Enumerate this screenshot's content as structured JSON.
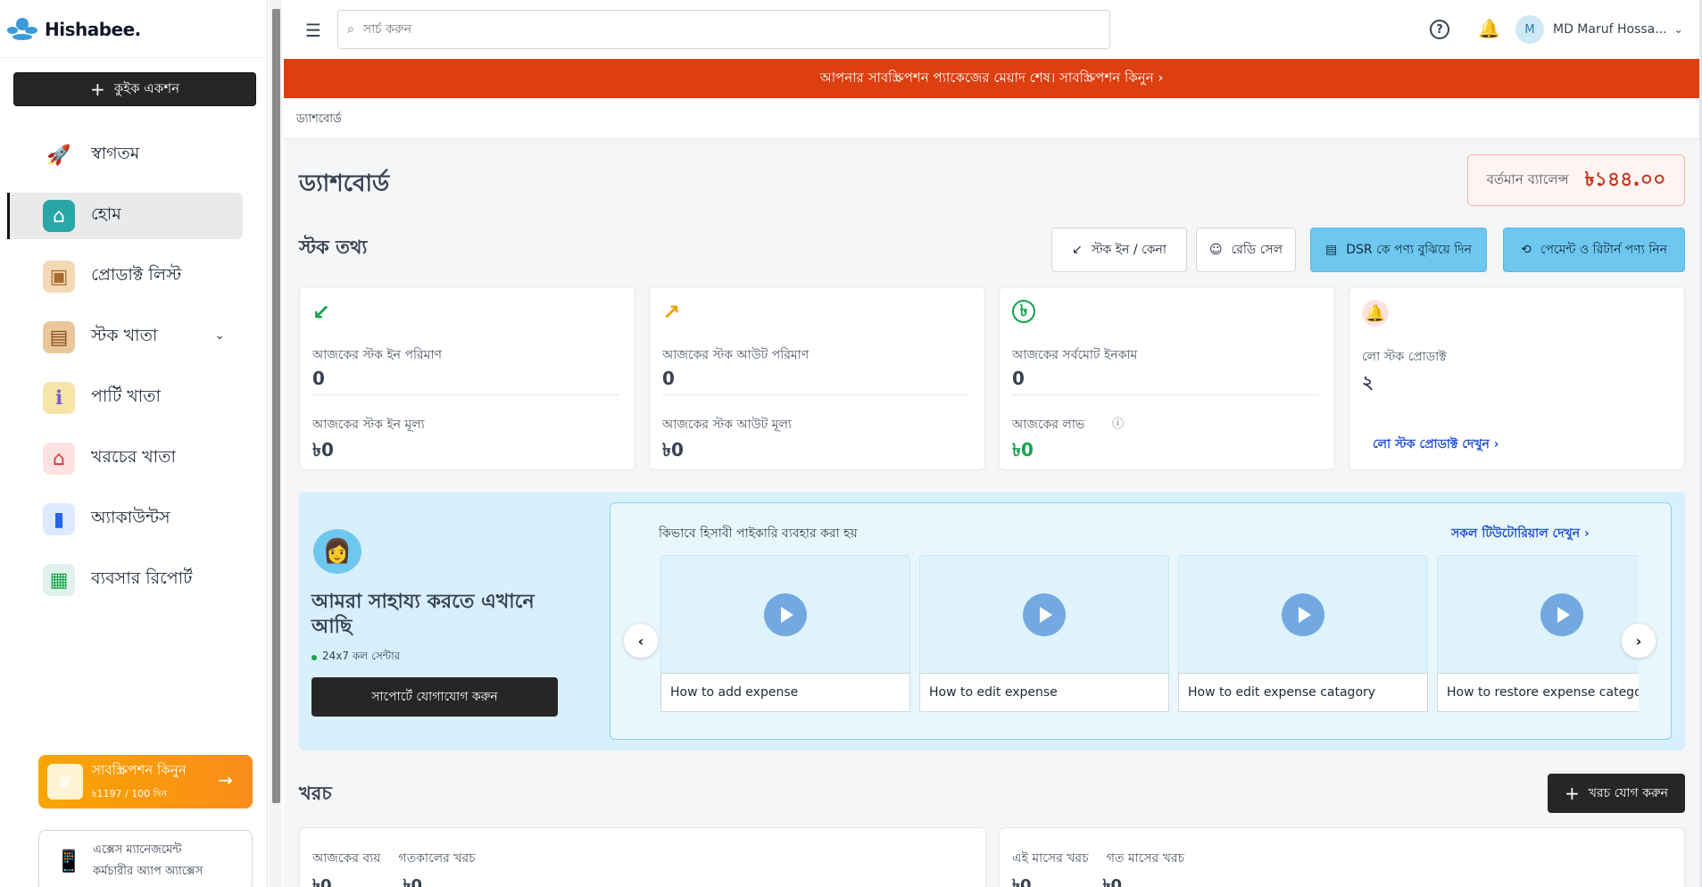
{
  "app": {
    "logo": "Hishabee."
  },
  "sidebar": {
    "quick_action": "কুইক একশন",
    "items": [
      {
        "label": "স্বাগতম",
        "icon": "rocket-icon"
      },
      {
        "label": "হোম",
        "icon": "home-icon"
      },
      {
        "label": "প্রোডাক্ট লিস্ট",
        "icon": "box-icon"
      },
      {
        "label": "স্টক খাতা",
        "icon": "stock-icon"
      },
      {
        "label": "পার্টি খাতা",
        "icon": "party-icon"
      },
      {
        "label": "খরচের খাতা",
        "icon": "expense-icon"
      },
      {
        "label": "অ্যাকাউন্টস",
        "icon": "accounts-icon"
      },
      {
        "label": "ব্যবসার রিপোর্ট",
        "icon": "report-icon"
      }
    ],
    "subscription": {
      "title": "সাবস্ক্রিপশন কিনুন",
      "price": "৳1197 / 100 দিন"
    },
    "access": {
      "line1": "এক্সেস ম্যানেজমেন্ট",
      "line2": "কর্মচারীর অ্যাপ অ্যাক্সেস"
    }
  },
  "topbar": {
    "search_placeholder": "সার্চ করুন",
    "user_initial": "M",
    "user_name": "MD Maruf Hossa..."
  },
  "alert": {
    "text": "আপনার সাবস্ক্রিপশন প্যাকেজের মেয়াদ শেষ। সাবস্ক্রিপশন কিনুন ›"
  },
  "breadcrumb": "ড্যাশবোর্ড",
  "main": {
    "title": "ড্যাশবোর্ড",
    "balance_label": "বর্তমান ব্যালেন্স",
    "balance_value": "৳১৪৪.০০",
    "stock_title": "স্টক তথ্য",
    "actions": {
      "stock_in": "স্টক ইন / কেনা",
      "ready_sale": "রেডি সেল",
      "dsr": "DSR কে পণ্য বুঝিয়ে দিন",
      "payment_return": "পেমেন্ট ও রিটার্ন পণ্য নিন"
    },
    "cards": {
      "stock_in": {
        "l1": "আজকের স্টক ইন পরিমাণ",
        "v1": "0",
        "l2": "আজকের স্টক ইন মূল্য",
        "v2": "৳0"
      },
      "stock_out": {
        "l1": "আজকের স্টক আউট পরিমাণ",
        "v1": "0",
        "l2": "আজকের স্টক আউট মূল্য",
        "v2": "৳0"
      },
      "income": {
        "l1": "আজকের সর্বমোট ইনকাম",
        "v1": "0",
        "l2": "আজকের লাভ",
        "v2": "৳0"
      },
      "low_stock": {
        "l1": "লো স্টক প্রোডাক্ট",
        "v1": "২",
        "link": "লো স্টক প্রোডাক্ট দেখুন"
      }
    },
    "help": {
      "title": "আমরা সাহায্য করতে এখানে আছি",
      "sub": "24x7 কল সেন্টার",
      "button": "সাপোর্টে যোগাযোগ করুন"
    },
    "tutorial": {
      "title": "কিভাবে হিসাবী পাইকারি ব্যবহার করা হয়",
      "link": "সকল টিউটোরিয়াল দেখুন",
      "videos": [
        "How to add expense",
        "How to edit expense",
        "How to edit expense catagory",
        "How to restore expense category"
      ]
    },
    "expense_title": "খরচ",
    "add_expense": "খরচ যোগ করুন",
    "expense_left": {
      "l1": "আজকের ব্যয়",
      "l2": "গতকালের খরচ",
      "v1": "৳0",
      "v2": "৳0"
    },
    "expense_right": {
      "l1": "এই মাসের খরচ",
      "l2": "গত মাসের খরচ",
      "v1": "৳0",
      "v2": "৳0"
    }
  },
  "colors": {
    "accent": "#6ec7ef",
    "alert": "#dd3f10",
    "dark": "#262626"
  }
}
